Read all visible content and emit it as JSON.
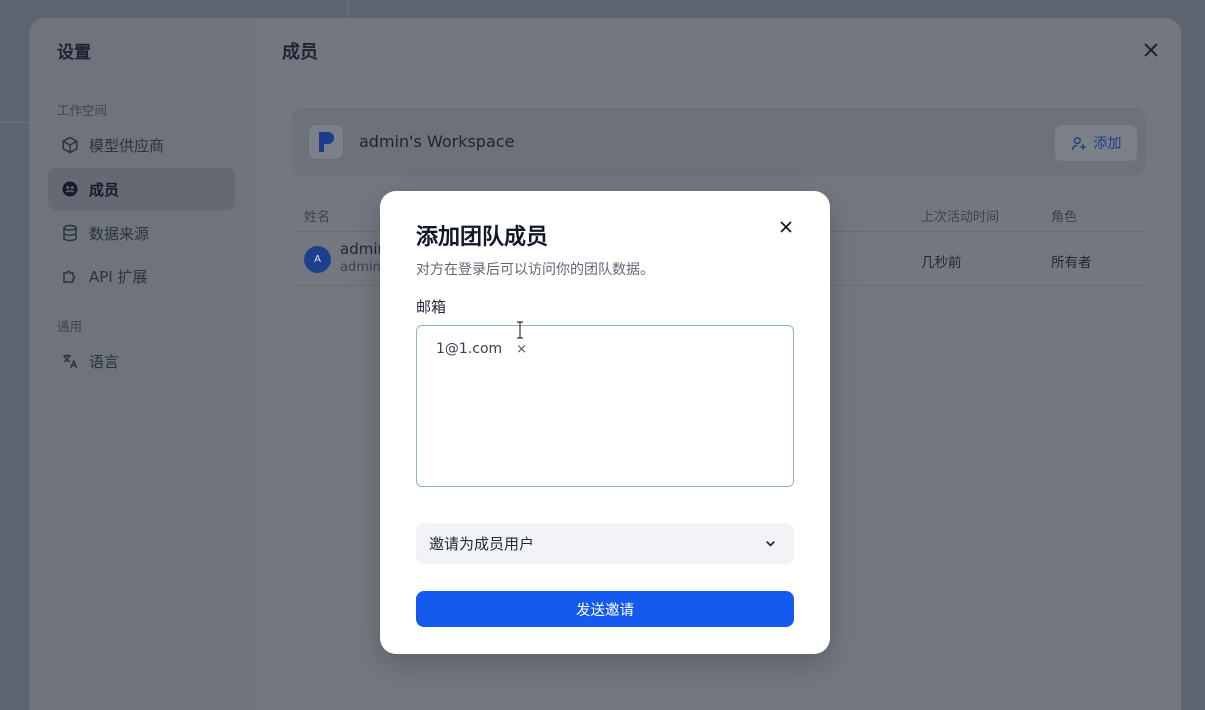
{
  "settings": {
    "title": "设置",
    "groups": {
      "workspace": "工作空间",
      "general": "通用"
    },
    "nav": [
      {
        "label": "模型供应商",
        "icon": "cube-icon"
      },
      {
        "label": "成员",
        "icon": "users-icon",
        "active": true
      },
      {
        "label": "数据来源",
        "icon": "database-icon"
      },
      {
        "label": "API 扩展",
        "icon": "puzzle-icon"
      },
      {
        "label": "语言",
        "icon": "translate-icon"
      }
    ]
  },
  "members": {
    "title": "成员",
    "workspace_name": "admin's Workspace",
    "add_label": "添加",
    "columns": {
      "name": "姓名",
      "last_active": "上次活动时间",
      "role": "角色"
    },
    "rows": [
      {
        "avatar": "A",
        "name": "admin",
        "email": "admin",
        "last_active": "几秒前",
        "role": "所有者"
      }
    ]
  },
  "dialog": {
    "title": "添加团队成员",
    "subtitle": "对方在登录后可以访问你的团队数据。",
    "email_label": "邮箱",
    "emails": [
      "1@1.com"
    ],
    "remove_glyph": "×",
    "role_option": "邀请为成员用户",
    "send_label": "发送邀请"
  },
  "colors": {
    "primary": "#155aef",
    "input_border": "#8fb4c6"
  }
}
